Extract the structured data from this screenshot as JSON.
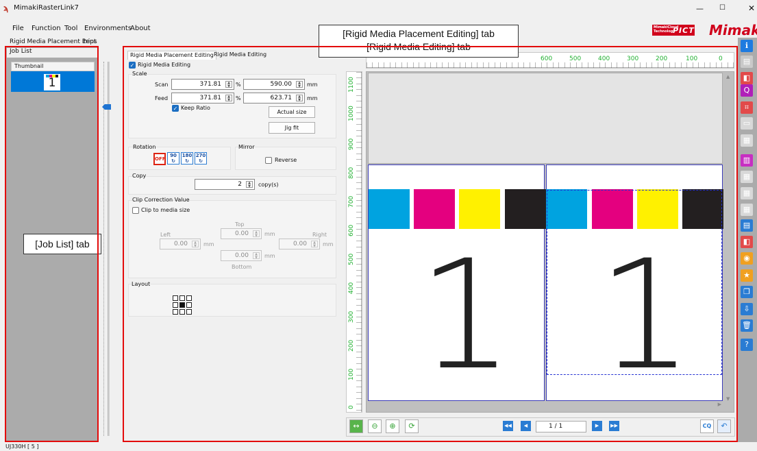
{
  "window": {
    "title": "MimakiRasterLink7",
    "min": "—",
    "max": "☐",
    "close": "✕"
  },
  "menu": [
    "File",
    "Function",
    "Tool",
    "Environments",
    "About"
  ],
  "brand": {
    "pict_small": "MimakiCloud Technology",
    "pict": "PICT",
    "mimaki": "Mimak"
  },
  "subheader": {
    "mode": "Rigid Media Placement Print",
    "file": "1eps"
  },
  "job_list": {
    "tab": "Job List",
    "column": "Thumbnail",
    "thumb_number": "1",
    "callout": "[Job List] tab"
  },
  "tabs": {
    "placement": "Rigid Media Placement Editing",
    "editing": "Rigid Media Editing"
  },
  "callout_tabs": {
    "line1": "[Rigid Media Placement Editing] tab",
    "line2": "[Rigid Media Editing] tab"
  },
  "settings": {
    "rigid_media_editing": "Rigid Media Editing",
    "scale": {
      "label": "Scale",
      "scan_label": "Scan",
      "scan_pct": "371.81",
      "scan_mm": "590.00",
      "feed_label": "Feed",
      "feed_pct": "371.81",
      "feed_mm": "623.71",
      "pct_unit": "%",
      "mm_unit": "mm",
      "keep_ratio": "Keep Ratio",
      "actual_size": "Actual size",
      "jig_fit": "Jig fit"
    },
    "rotation": {
      "label": "Rotation",
      "off": "OFF",
      "r90": "90",
      "r180": "180",
      "r270": "270"
    },
    "mirror": {
      "label": "Mirror",
      "reverse": "Reverse"
    },
    "copy": {
      "label": "Copy",
      "value": "2",
      "unit": "copy(s)"
    },
    "clip": {
      "label": "Clip Correction Value",
      "clip_to_media": "Clip to media size",
      "top_label": "Top",
      "top": "0.00",
      "left_label": "Left",
      "left": "0.00",
      "right_label": "Right",
      "right": "0.00",
      "bottom_label": "Bottom",
      "bottom": "0.00",
      "unit": "mm"
    },
    "layout": {
      "label": "Layout",
      "selected_cell": 4
    }
  },
  "preview": {
    "hruler_ticks": [
      "600",
      "500",
      "400",
      "300",
      "200",
      "100",
      "0"
    ],
    "vruler_ticks": [
      "1100",
      "1000",
      "900",
      "800",
      "700",
      "600",
      "500",
      "400",
      "300",
      "200",
      "100",
      "0"
    ],
    "page_number": "1",
    "swatch_colors": [
      "#00a3e0",
      "#e4007f",
      "#fff100",
      "#231f20"
    ],
    "page_indicator": "1 / 1"
  },
  "status": "UJ330H [ 5 ]"
}
